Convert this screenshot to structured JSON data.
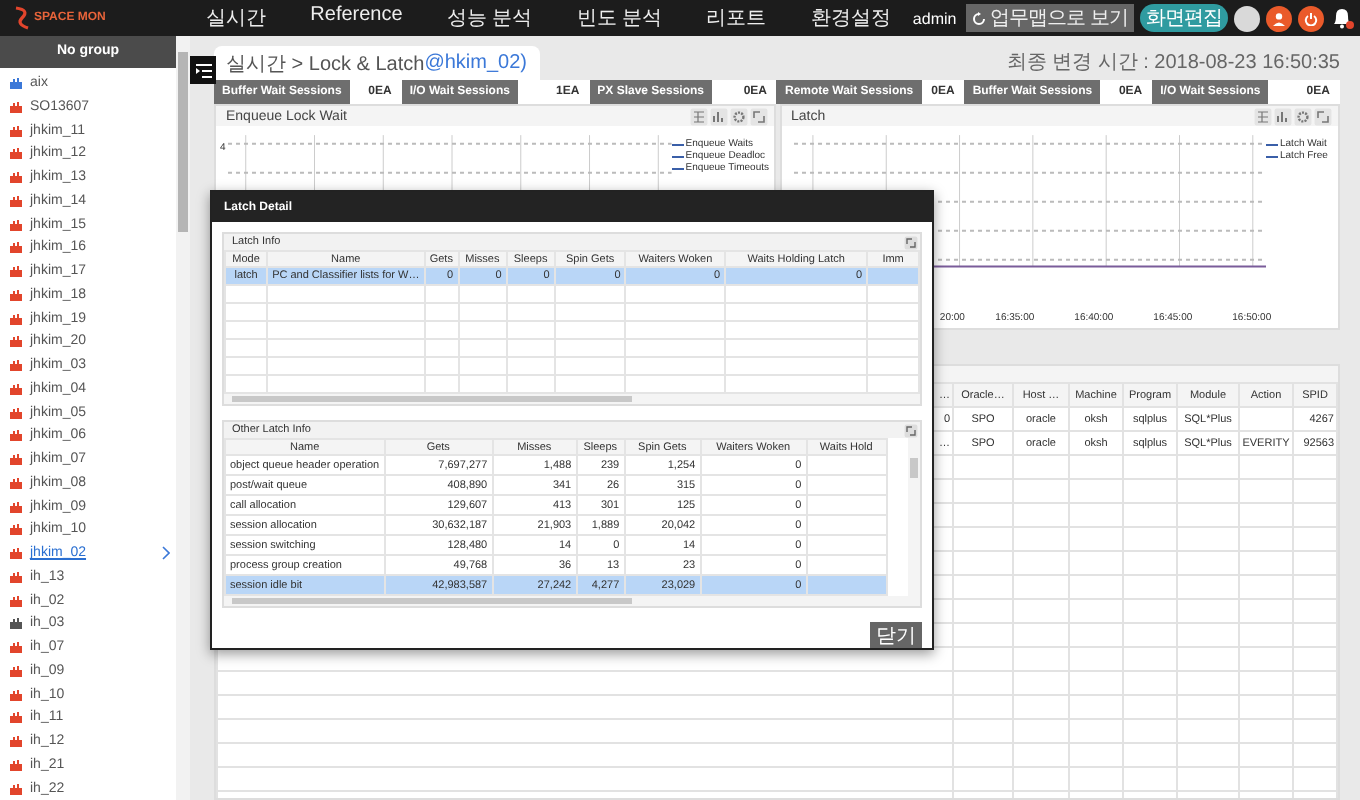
{
  "topbar": {
    "logo": "SPACE MON",
    "nav": [
      "실시간",
      "Reference",
      "성능 분석",
      "빈도 분석",
      "리포트",
      "환경설정"
    ],
    "user": "admin",
    "map_button": "업무맵으로 보기",
    "edit_button": "화면편집"
  },
  "sidebar": {
    "header": "No group",
    "items": [
      {
        "label": "aix",
        "color": "#3b78d8",
        "selected": false
      },
      {
        "label": "SO13607",
        "color": "#e2452c",
        "selected": false
      },
      {
        "label": "jhkim_11",
        "color": "#e2452c",
        "selected": false
      },
      {
        "label": "jhkim_12",
        "color": "#e2452c",
        "selected": false
      },
      {
        "label": "jhkim_13",
        "color": "#e2452c",
        "selected": false
      },
      {
        "label": "jhkim_14",
        "color": "#e2452c",
        "selected": false
      },
      {
        "label": "jhkim_15",
        "color": "#e2452c",
        "selected": false
      },
      {
        "label": "jhkim_16",
        "color": "#e2452c",
        "selected": false
      },
      {
        "label": "jhkim_17",
        "color": "#e2452c",
        "selected": false
      },
      {
        "label": "jhkim_18",
        "color": "#e2452c",
        "selected": false
      },
      {
        "label": "jhkim_19",
        "color": "#e2452c",
        "selected": false
      },
      {
        "label": "jhkim_20",
        "color": "#e2452c",
        "selected": false
      },
      {
        "label": "jhkim_03",
        "color": "#e2452c",
        "selected": false
      },
      {
        "label": "jhkim_04",
        "color": "#e2452c",
        "selected": false
      },
      {
        "label": "jhkim_05",
        "color": "#e2452c",
        "selected": false
      },
      {
        "label": "jhkim_06",
        "color": "#e2452c",
        "selected": false
      },
      {
        "label": "jhkim_07",
        "color": "#e2452c",
        "selected": false
      },
      {
        "label": "jhkim_08",
        "color": "#e2452c",
        "selected": false
      },
      {
        "label": "jhkim_09",
        "color": "#e2452c",
        "selected": false
      },
      {
        "label": "jhkim_10",
        "color": "#e2452c",
        "selected": false
      },
      {
        "label": "jhkim_02",
        "color": "#e2452c",
        "selected": true
      },
      {
        "label": "ih_13",
        "color": "#e2452c",
        "selected": false
      },
      {
        "label": "ih_02",
        "color": "#e2452c",
        "selected": false
      },
      {
        "label": "ih_03",
        "color": "#555555",
        "selected": false
      },
      {
        "label": "ih_07",
        "color": "#e2452c",
        "selected": false
      },
      {
        "label": "ih_09",
        "color": "#e2452c",
        "selected": false
      },
      {
        "label": "ih_10",
        "color": "#e2452c",
        "selected": false
      },
      {
        "label": "ih_11",
        "color": "#e2452c",
        "selected": false
      },
      {
        "label": "ih_12",
        "color": "#e2452c",
        "selected": false
      },
      {
        "label": "ih_21",
        "color": "#e2452c",
        "selected": false
      },
      {
        "label": "ih_22",
        "color": "#e2452c",
        "selected": false
      }
    ]
  },
  "breadcrumb": {
    "path": "실시간 > Lock & Latch ",
    "target": "@hkim_02)"
  },
  "last_updated": "최종 변경 시간 : 2018-08-23 16:50:35",
  "session_counters": [
    {
      "label": "Buffer Wait Sessions",
      "count": "0EA"
    },
    {
      "label": "I/O Wait Sessions",
      "count": "1EA"
    },
    {
      "label": "PX Slave Sessions",
      "count": "0EA"
    },
    {
      "label": "Remote Wait Sessions",
      "count": "0EA"
    },
    {
      "label": "Buffer Wait Sessions",
      "count": "0EA"
    },
    {
      "label": "I/O Wait Sessions",
      "count": "0EA"
    }
  ],
  "charts": [
    {
      "title": "Enqueue Lock Wait",
      "y_labels": [
        "4"
      ],
      "legend": [
        "Enqueue Waits",
        "Enqueue Deadloc",
        "Enqueue Timeouts"
      ]
    },
    {
      "title": "Latch",
      "x_labels": [
        "20:00",
        "16:35:00",
        "16:40:00",
        "16:45:00",
        "16:50:00"
      ],
      "legend": [
        "Latch Wait",
        "Latch Free"
      ]
    }
  ],
  "sessions_table": {
    "columns": [
      "…",
      "Oracle…",
      "Host …",
      "Machine",
      "Program",
      "Module",
      "Action",
      "SPID"
    ],
    "rows": [
      [
        "0",
        "SPO",
        "oracle",
        "oksh",
        "sqlplus",
        "SQL*Plus",
        "",
        "4267"
      ],
      [
        "…",
        "SPO",
        "oracle",
        "oksh",
        "sqlplus",
        "SQL*Plus",
        "EVERITY",
        "92563"
      ]
    ]
  },
  "latch_detail": {
    "title": "Latch Detail",
    "latch_info": {
      "title": "Latch Info",
      "columns": [
        "Mode",
        "Name",
        "Gets",
        "Misses",
        "Sleeps",
        "Spin Gets",
        "Waiters Woken",
        "Waits Holding Latch",
        "Imm"
      ],
      "rows": [
        {
          "cells": [
            "latch",
            "PC and Classifier lists for W…",
            "0",
            "0",
            "0",
            "0",
            "0",
            "0",
            ""
          ],
          "selected": true
        }
      ]
    },
    "other_latch_info": {
      "title": "Other Latch Info",
      "columns": [
        "Name",
        "Gets",
        "Misses",
        "Sleeps",
        "Spin Gets",
        "Waiters Woken",
        "Waits Hold"
      ],
      "rows": [
        {
          "cells": [
            "object queue header operation",
            "7,697,277",
            "1,488",
            "239",
            "1,254",
            "0",
            ""
          ],
          "selected": false
        },
        {
          "cells": [
            "post/wait queue",
            "408,890",
            "341",
            "26",
            "315",
            "0",
            ""
          ],
          "selected": false
        },
        {
          "cells": [
            "call allocation",
            "129,607",
            "413",
            "301",
            "125",
            "0",
            ""
          ],
          "selected": false
        },
        {
          "cells": [
            "session allocation",
            "30,632,187",
            "21,903",
            "1,889",
            "20,042",
            "0",
            ""
          ],
          "selected": false
        },
        {
          "cells": [
            "session switching",
            "128,480",
            "14",
            "0",
            "14",
            "0",
            ""
          ],
          "selected": false
        },
        {
          "cells": [
            "process group creation",
            "49,768",
            "36",
            "13",
            "23",
            "0",
            ""
          ],
          "selected": false
        },
        {
          "cells": [
            "session idle bit",
            "42,983,587",
            "27,242",
            "4,277",
            "23,029",
            "0",
            ""
          ],
          "selected": true
        }
      ]
    },
    "close_button": "닫기"
  }
}
